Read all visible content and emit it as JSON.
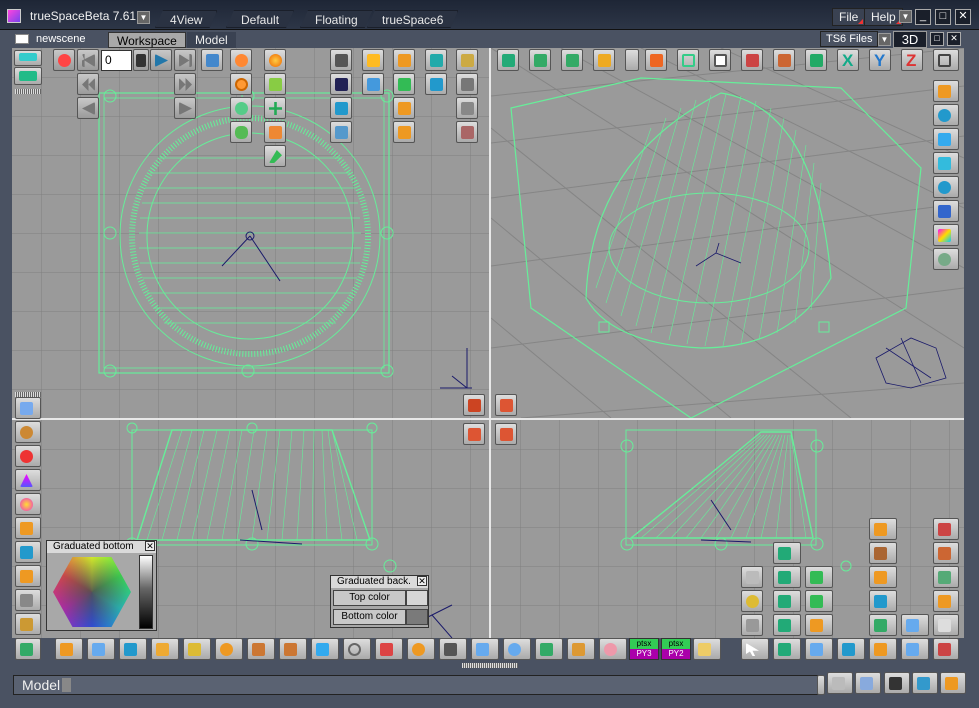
{
  "window": {
    "title": "trueSpaceBeta 7.61",
    "layout_tabs": [
      "4View",
      "Default",
      "Floating",
      "trueSpace6"
    ],
    "menu_file": "File",
    "menu_help": "Help",
    "min": "_",
    "max": "□",
    "close": "✕"
  },
  "scene": {
    "name": "newscene",
    "tabs": [
      "Workspace",
      "Model"
    ],
    "ts6_files": "TS6 Files",
    "view_mode": "3D",
    "frame_value": "0"
  },
  "graduated_bottom": {
    "title": "Graduated bottom"
  },
  "graduated_back": {
    "title": "Graduated back.",
    "top_color": "Top color",
    "bottom_color": "Bottom color",
    "top_swatch": "#d6d6d6",
    "bottom_swatch": "#7a7a7a"
  },
  "bottom_toolbar": {
    "pill1_top": "ptsx",
    "pill1_bottom": "PY3",
    "pill2_top": "ptsx",
    "pill2_bottom": "PY2"
  },
  "status": {
    "mode": "Model"
  },
  "colors": {
    "wire": "#66ee99",
    "viewport_bg": "#9a9a9a",
    "grid": "#7d7d7d",
    "chrome": "#4a5262"
  }
}
